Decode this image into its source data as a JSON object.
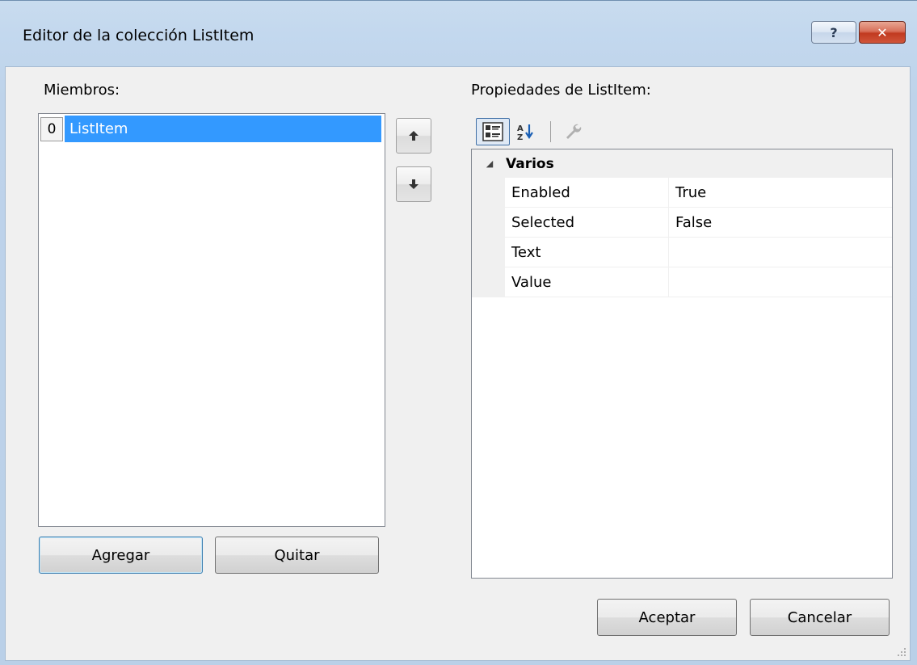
{
  "window": {
    "title": "Editor de la colección ListItem",
    "help_label": "?",
    "close_label": "✕"
  },
  "members": {
    "label": "Miembros:",
    "items": [
      {
        "index": "0",
        "label": "ListItem",
        "selected": true
      }
    ],
    "add_label": "Agregar",
    "remove_label": "Quitar"
  },
  "properties": {
    "label": "Propiedades de ListItem:",
    "toolbar": {
      "categorized_icon": "categorized-view-icon",
      "alphabetical_icon": "alphabetical-sort-icon",
      "property_pages_icon": "wrench-icon"
    },
    "category": {
      "name": "Varios",
      "toggle": "◢"
    },
    "rows": [
      {
        "name": "Enabled",
        "value": "True"
      },
      {
        "name": "Selected",
        "value": "False"
      },
      {
        "name": "Text",
        "value": ""
      },
      {
        "name": "Value",
        "value": ""
      }
    ]
  },
  "footer": {
    "ok_label": "Aceptar",
    "cancel_label": "Cancelar"
  },
  "colors": {
    "selection": "#3399ff",
    "window_frame": "#bfd4ea",
    "client_bg": "#f0f0f0"
  }
}
